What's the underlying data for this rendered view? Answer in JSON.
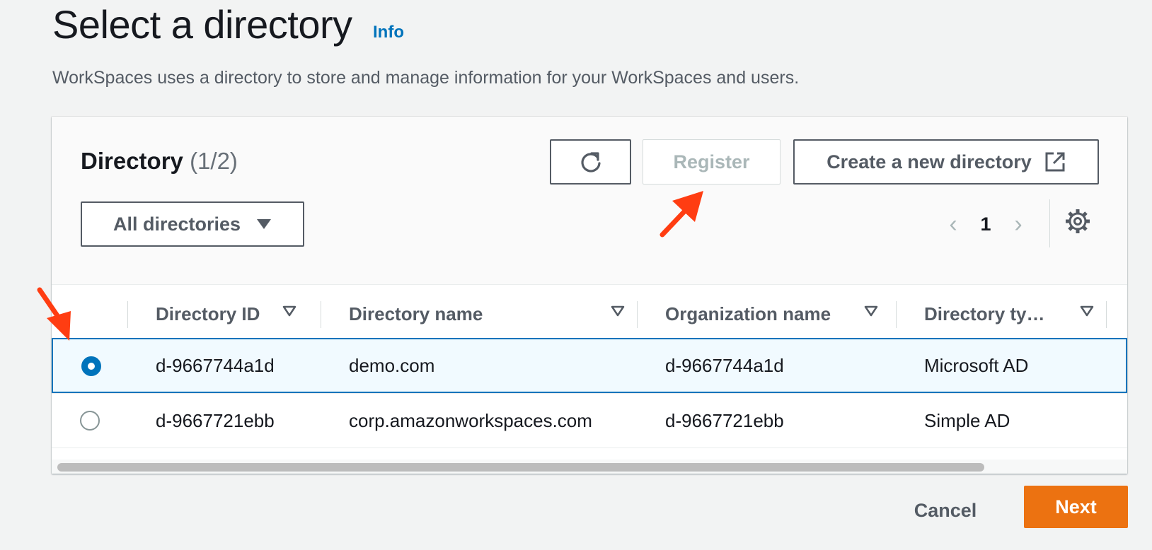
{
  "header": {
    "title": "Select a directory",
    "info_link": "Info",
    "description": "WorkSpaces uses a directory to store and manage information for your WorkSpaces and users."
  },
  "panel": {
    "title": "Directory",
    "count": "(1/2)",
    "refresh_icon": "refresh-icon",
    "register_label": "Register",
    "create_label": "Create a new directory",
    "external_icon": "external-link-icon",
    "filter_label": "All directories",
    "pagination": {
      "current_page": "1"
    },
    "settings_icon": "gear-icon"
  },
  "table": {
    "columns": [
      "Directory ID",
      "Directory name",
      "Organization name",
      "Directory ty…"
    ],
    "rows": [
      {
        "selected": true,
        "directory_id": "d-9667744a1d",
        "directory_name": "demo.com",
        "organization_name": "d-9667744a1d",
        "directory_type": "Microsoft AD"
      },
      {
        "selected": false,
        "directory_id": "d-9667721ebb",
        "directory_name": "corp.amazonworkspaces.com",
        "organization_name": "d-9667721ebb",
        "directory_type": "Simple AD"
      }
    ]
  },
  "footer": {
    "cancel_label": "Cancel",
    "next_label": "Next"
  },
  "colors": {
    "accent": "#0073bb",
    "primary_button": "#ec7211",
    "annotation_arrow": "#ff3d12"
  }
}
